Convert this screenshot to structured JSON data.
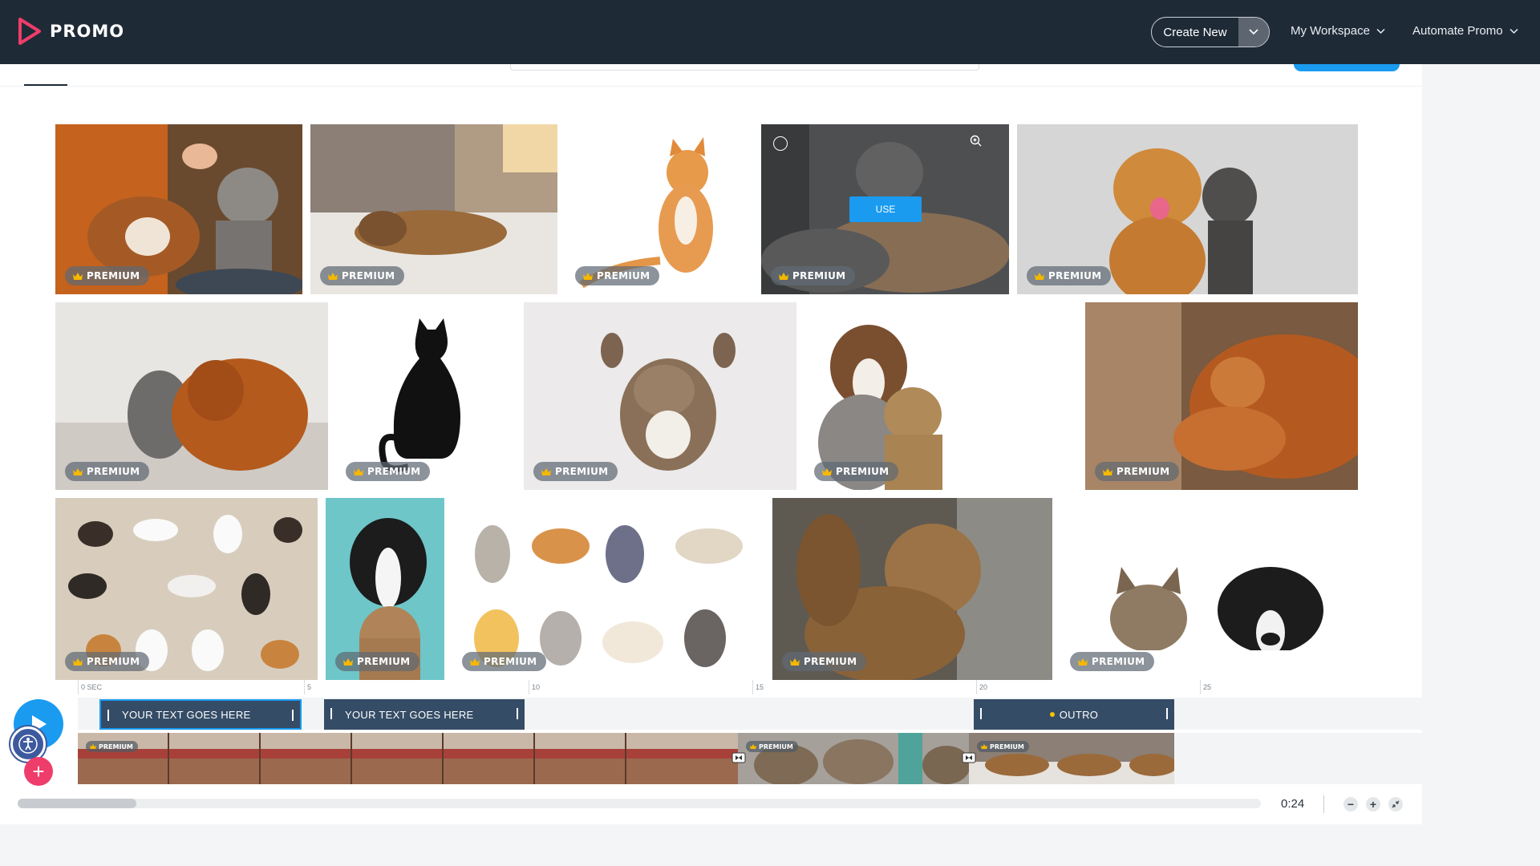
{
  "app": {
    "logo_text": "PROMO",
    "brand_color": "#ee3d6a",
    "accent_color": "#1a9bf0",
    "topbar_color": "#1f2a37"
  },
  "nav": {
    "create_new_label": "Create New",
    "workspace_label": "My Workspace",
    "automate_label": "Automate Promo"
  },
  "grid": {
    "badge_label": "PREMIUM",
    "use_label": "USE",
    "tiles": [
      {
        "subject": "person-petting-cat-and-dog"
      },
      {
        "subject": "cat-lying-on-sofa"
      },
      {
        "subject": "orange-cat-sitting"
      },
      {
        "subject": "cat-and-dog-sleeping"
      },
      {
        "subject": "golden-retriever-and-cat"
      },
      {
        "subject": "kitten-and-spaniel"
      },
      {
        "subject": "cat-silhouette"
      },
      {
        "subject": "kitten-on-blanket"
      },
      {
        "subject": "aussie-dog-and-cat"
      },
      {
        "subject": "orange-cat-on-pillow"
      },
      {
        "subject": "cat-illustrations-beige"
      },
      {
        "subject": "border-collie-and-kitten"
      },
      {
        "subject": "cartoon-cats-set"
      },
      {
        "subject": "tabby-cat-closeup"
      },
      {
        "subject": "cat-and-dog-peeking"
      }
    ]
  },
  "timeline": {
    "ruler": [
      "0 SEC",
      "5",
      "10",
      "15",
      "20",
      "25"
    ],
    "text_clips": [
      {
        "label": "YOUR TEXT GOES HERE"
      },
      {
        "label": "YOUR TEXT GOES HERE"
      },
      {
        "label": "OUTRO"
      }
    ],
    "video_badge_label": "PREMIUM",
    "duration": "0:24",
    "zoom_out": "−",
    "zoom_in": "+",
    "plus_label": "+"
  }
}
